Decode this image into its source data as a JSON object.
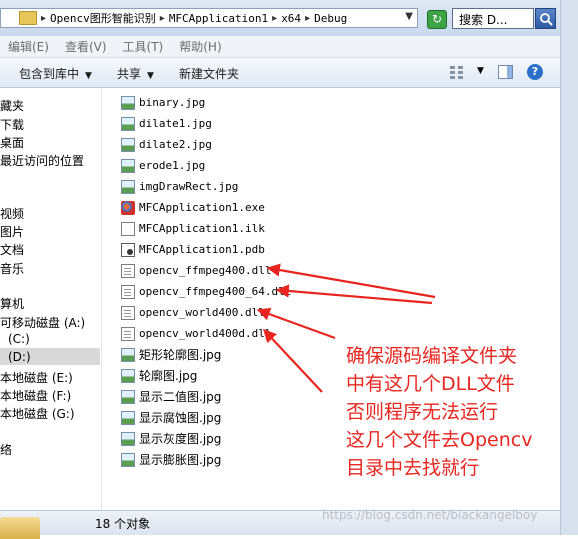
{
  "address": {
    "crumbs": [
      "Opencv图形智能识别",
      "MFCApplication1",
      "x64",
      "Debug"
    ],
    "search_placeholder": "搜索 D..."
  },
  "menu": [
    "编辑(E)",
    "查看(V)",
    "工具(T)",
    "帮助(H)"
  ],
  "toolbar": {
    "include_label": "包含到库中",
    "share_label": "共享",
    "new_folder_label": "新建文件夹"
  },
  "nav": {
    "items": [
      "藏夹",
      "下载",
      "桌面",
      "最近访问的位置",
      "视频",
      "图片",
      "文档",
      "音乐",
      "算机",
      "可移动磁盘 (A:)",
      "(C:)",
      "(D:)",
      "本地磁盘 (E:)",
      "本地磁盘 (F:)",
      "本地磁盘 (G:)",
      "络"
    ],
    "selected": "(D:)"
  },
  "files": [
    {
      "name": "binary.jpg",
      "type": "img"
    },
    {
      "name": "dilate1.jpg",
      "type": "img"
    },
    {
      "name": "dilate2.jpg",
      "type": "img"
    },
    {
      "name": "erode1.jpg",
      "type": "img"
    },
    {
      "name": "imgDrawRect.jpg",
      "type": "img"
    },
    {
      "name": "MFCApplication1.exe",
      "type": "exe"
    },
    {
      "name": "MFCApplication1.ilk",
      "type": "ilk"
    },
    {
      "name": "MFCApplication1.pdb",
      "type": "pdb"
    },
    {
      "name": "opencv_ffmpeg400.dll",
      "type": "dll"
    },
    {
      "name": "opencv_ffmpeg400_64.dll",
      "type": "dll"
    },
    {
      "name": "opencv_world400.dll",
      "type": "dll"
    },
    {
      "name": "opencv_world400d.dll",
      "type": "dll"
    },
    {
      "name": "矩形轮廓图.jpg",
      "type": "img"
    },
    {
      "name": "轮廓图.jpg",
      "type": "img"
    },
    {
      "name": "显示二值图.jpg",
      "type": "img"
    },
    {
      "name": "显示腐蚀图.jpg",
      "type": "img"
    },
    {
      "name": "显示灰度图.jpg",
      "type": "img"
    },
    {
      "name": "显示膨胀图.jpg",
      "type": "img"
    }
  ],
  "annotation": {
    "lines": [
      "确保源码编译文件夹",
      "中有这几个DLL文件",
      "否则程序无法运行",
      "这几个文件去Opencv",
      "目录中去找就行"
    ],
    "color": "#e8261f"
  },
  "status": {
    "count_label": "18 个对象"
  },
  "watermark": "https://blog.csdn.net/blackangelboy"
}
